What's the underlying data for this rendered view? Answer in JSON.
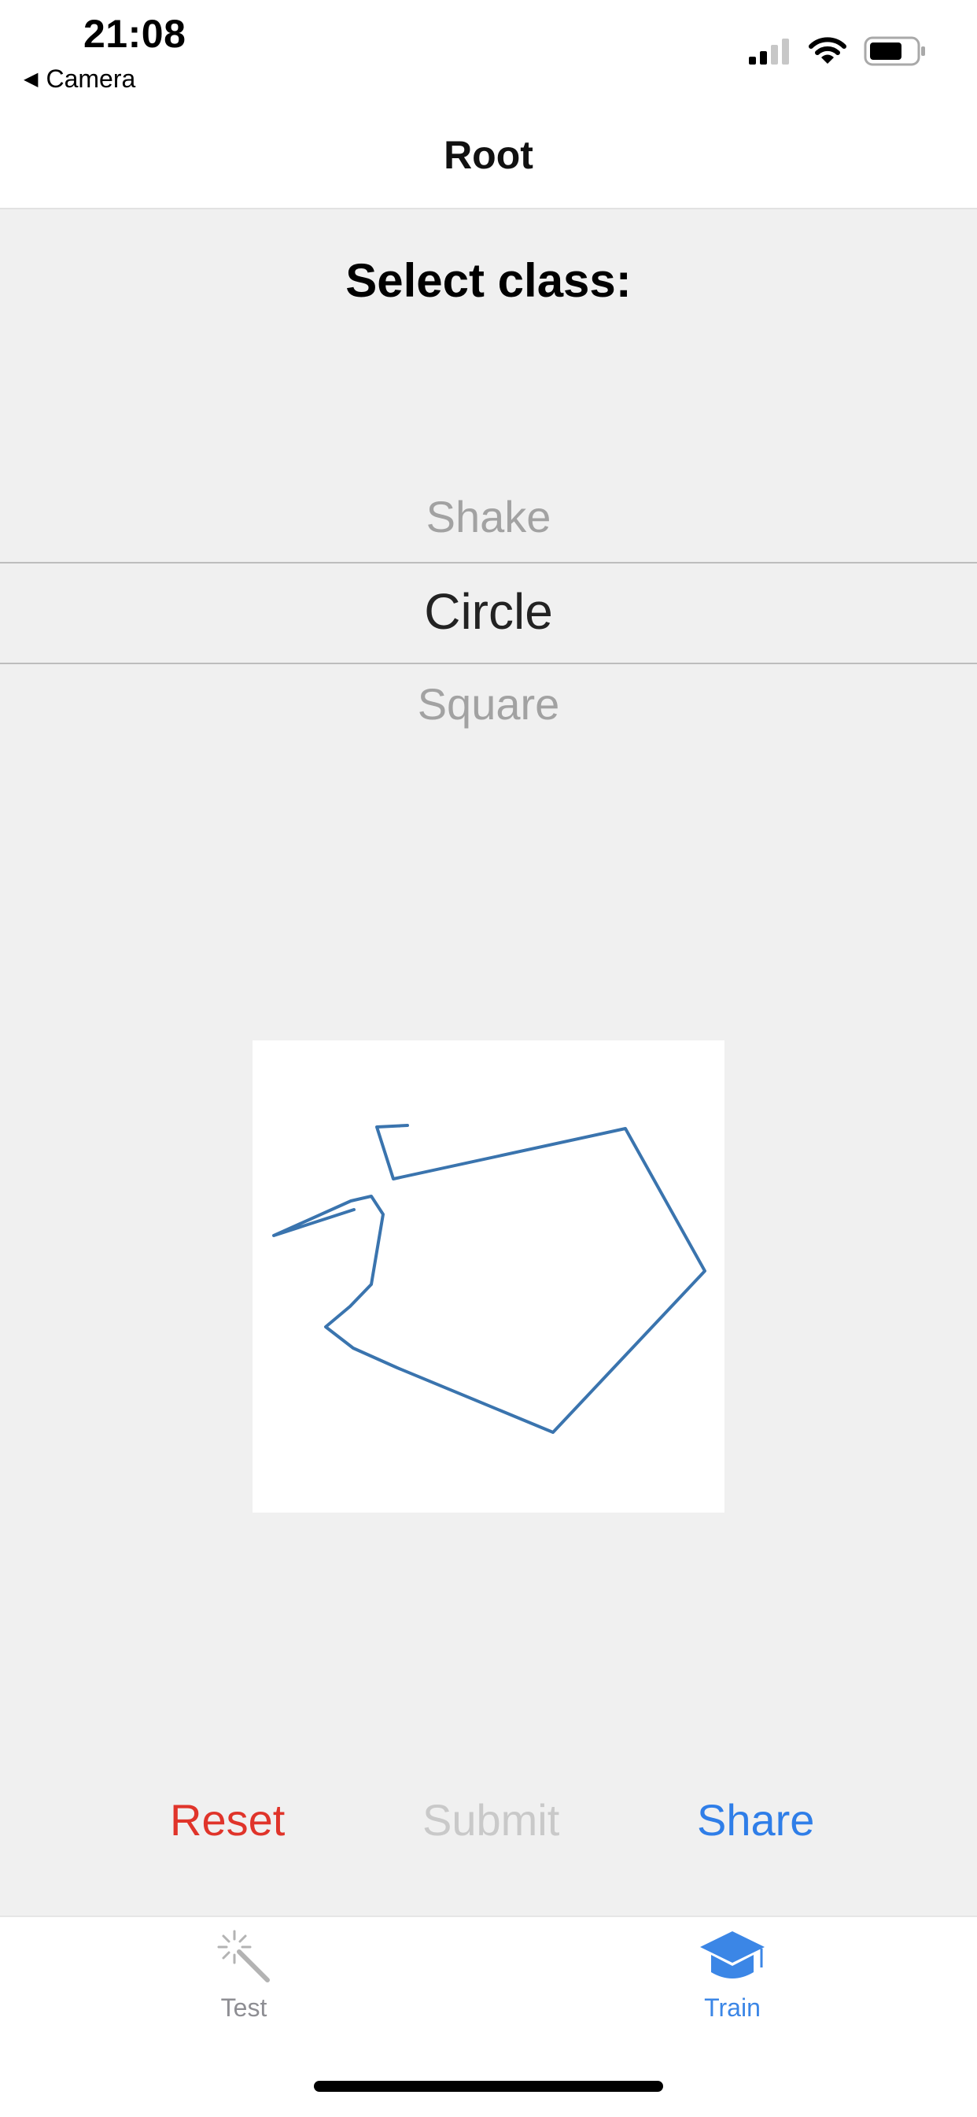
{
  "status_bar": {
    "time": "21:08",
    "back_app": "Camera",
    "icons": [
      "signal-icon",
      "wifi-icon",
      "battery-icon"
    ]
  },
  "nav": {
    "title": "Root"
  },
  "select": {
    "title": "Select class:"
  },
  "picker": {
    "options": [
      "Shake",
      "Circle",
      "Square"
    ],
    "selected": "Circle"
  },
  "actions": {
    "reset_label": "Reset",
    "submit_label": "Submit",
    "share_label": "Share"
  },
  "tabs": [
    {
      "label": "Test",
      "icon": "magic-wand-icon",
      "active": false
    },
    {
      "label": "Train",
      "icon": "graduation-cap-icon",
      "active": true
    }
  ],
  "colors": {
    "reset": "#e0342a",
    "submit_disabled": "#c9c9c9",
    "share": "#2f7ee8",
    "tab_active": "#3b86e6",
    "tab_inactive": "#8e8e93",
    "stroke": "#3a74ae",
    "background": "#f0f0f0"
  }
}
